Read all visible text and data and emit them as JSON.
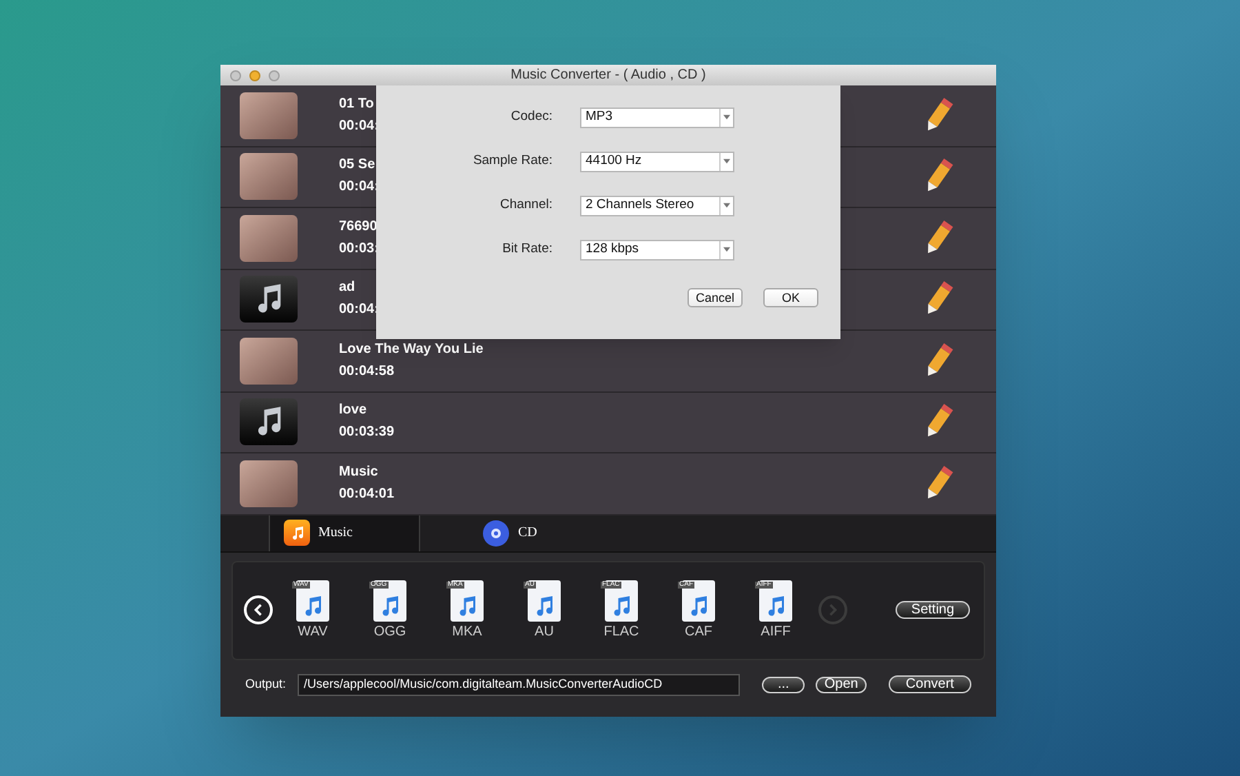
{
  "window": {
    "title": "Music Converter - ( Audio , CD )"
  },
  "tracks": [
    {
      "title": "01 To",
      "duration": "00:04:",
      "kind": "photo"
    },
    {
      "title": "05 Se",
      "duration": "00:04:",
      "kind": "photo"
    },
    {
      "title": "76690",
      "duration": "00:03:",
      "kind": "photo"
    },
    {
      "title": "ad",
      "duration": "00:04:",
      "kind": "note"
    },
    {
      "title": "Love The Way You Lie",
      "duration": "00:04:58",
      "kind": "photo"
    },
    {
      "title": "love",
      "duration": "00:03:39",
      "kind": "note"
    },
    {
      "title": "Music",
      "duration": "00:04:01",
      "kind": "photo"
    }
  ],
  "tabs": [
    {
      "label": "Music",
      "kind": "music",
      "selected": true
    },
    {
      "label": "CD",
      "kind": "cd",
      "selected": false
    }
  ],
  "formats": {
    "prev_disabled": false,
    "next_disabled": true,
    "items": [
      {
        "tag": "WAV",
        "label": "WAV"
      },
      {
        "tag": "OGG",
        "label": "OGG"
      },
      {
        "tag": "MKA",
        "label": "MKA"
      },
      {
        "tag": "AU",
        "label": "AU"
      },
      {
        "tag": "FLAC",
        "label": "FLAC"
      },
      {
        "tag": "CAF",
        "label": "CAF"
      },
      {
        "tag": "AIFF",
        "label": "AIFF"
      }
    ],
    "setting_button": "Setting"
  },
  "output": {
    "label": "Output:",
    "path": "/Users/applecool/Music/com.digitalteam.MusicConverterAudioCD",
    "browse_button": "...",
    "open_button": "Open",
    "convert_button": "Convert"
  },
  "dialog": {
    "fields": [
      {
        "label": "Codec:",
        "value": "MP3"
      },
      {
        "label": "Sample Rate:",
        "value": "44100 Hz"
      },
      {
        "label": "Channel:",
        "value": "2 Channels Stereo"
      },
      {
        "label": "Bit Rate:",
        "value": "128 kbps"
      }
    ],
    "buttons": [
      "Cancel",
      "OK"
    ]
  }
}
